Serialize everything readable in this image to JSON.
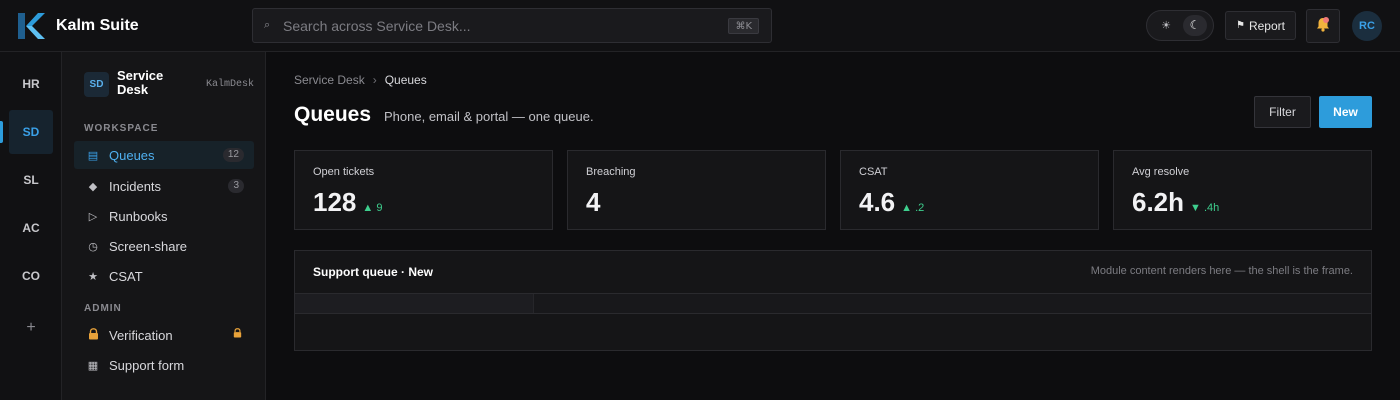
{
  "brand": {
    "name": "Kalm Suite"
  },
  "search": {
    "placeholder": "Search across Service Desk...",
    "shortcut": "⌘K"
  },
  "header": {
    "report_label": "Report"
  },
  "user": {
    "initials": "RC"
  },
  "rail": {
    "items": [
      "HR",
      "SD",
      "SL",
      "AC",
      "CO"
    ],
    "active": "SD",
    "add_label": "+"
  },
  "sidebar": {
    "badge": "SD",
    "title": "Service Desk",
    "subtitle": "KalmDesk",
    "sections": [
      {
        "title": "WORKSPACE",
        "items": [
          {
            "label": "Queues",
            "icon": "list-icon",
            "count": "12",
            "active": true
          },
          {
            "label": "Incidents",
            "icon": "diamond-icon",
            "count": "3"
          },
          {
            "label": "Runbooks",
            "icon": "play-icon"
          },
          {
            "label": "Screen-share",
            "icon": "clock-icon"
          },
          {
            "label": "CSAT",
            "icon": "star-icon"
          }
        ]
      },
      {
        "title": "ADMIN",
        "items": [
          {
            "label": "Verification",
            "icon": "lock-icon",
            "locked": true
          },
          {
            "label": "Support form",
            "icon": "grid-icon"
          }
        ]
      }
    ]
  },
  "breadcrumb": {
    "root": "Service Desk",
    "separator": "›",
    "current": "Queues"
  },
  "page": {
    "title": "Queues",
    "subtitle": "Phone, email & portal — one queue."
  },
  "actions": {
    "filter_label": "Filter",
    "new_label": "New"
  },
  "kpis": [
    {
      "label": "Open tickets",
      "value": "128",
      "delta": "▲ 9",
      "direction": "up"
    },
    {
      "label": "Breaching",
      "value": "4",
      "delta": "",
      "direction": "none"
    },
    {
      "label": "CSAT",
      "value": "4.6",
      "delta": "▲ .2",
      "direction": "up"
    },
    {
      "label": "Avg resolve",
      "value": "6.2h",
      "delta": "▼ .4h",
      "direction": "down"
    }
  ],
  "panel": {
    "title": "Support queue · New",
    "note": "Module content renders here — the shell is the frame."
  },
  "colors": {
    "accent": "#2d9cdb",
    "positive": "#3ecf8e",
    "notification": "#f07a7a",
    "lock": "#e8a23a"
  }
}
